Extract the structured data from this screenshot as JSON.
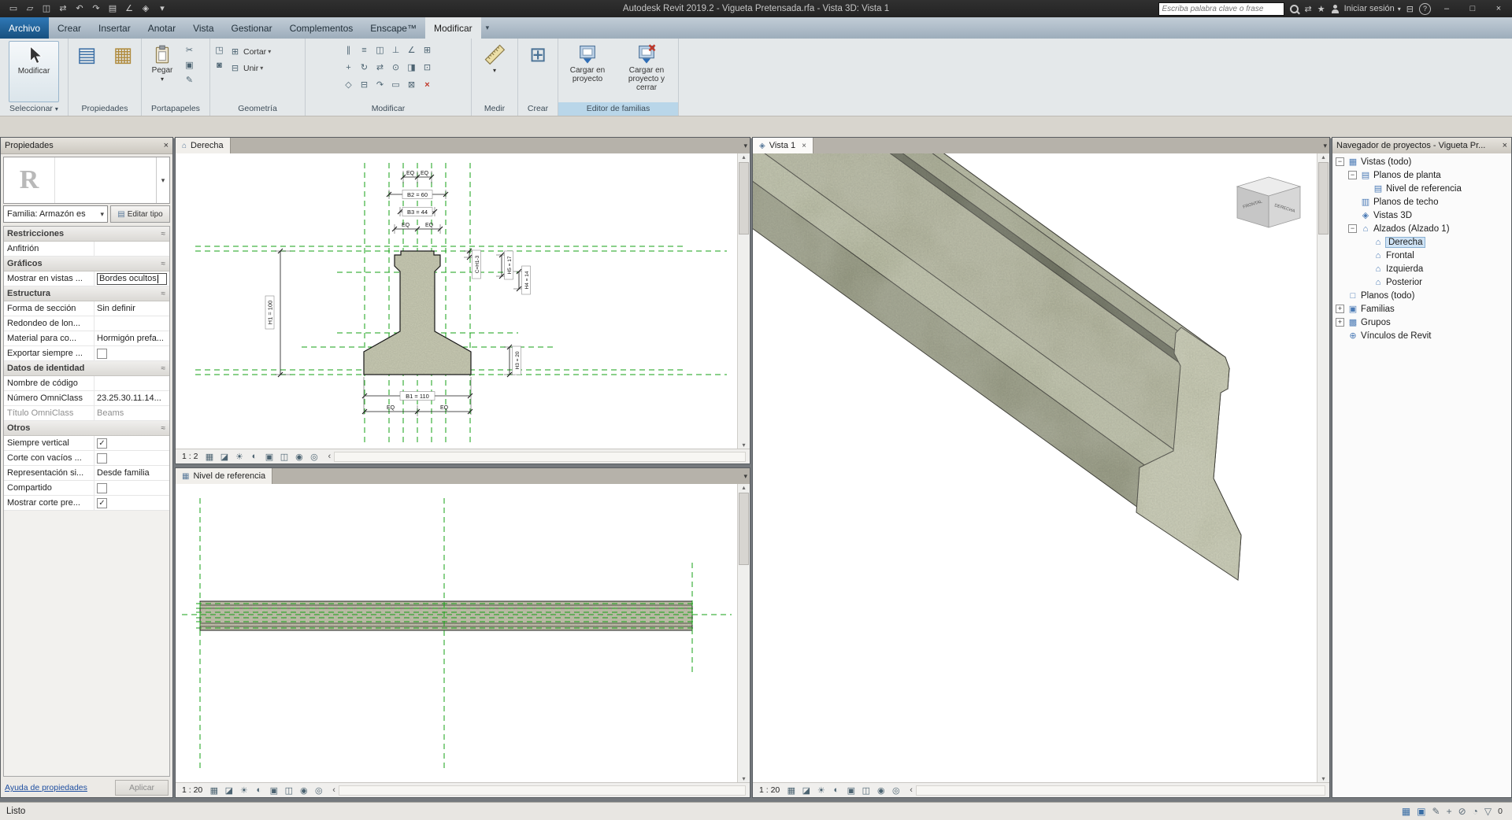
{
  "titlebar": {
    "title": "Autodesk Revit 2019.2 - Vigueta Pretensada.rfa - Vista 3D: Vista 1",
    "search_placeholder": "Escriba palabra clave o frase",
    "sign_in_label": "Iniciar sesión"
  },
  "tabs": [
    "Archivo",
    "Crear",
    "Insertar",
    "Anotar",
    "Vista",
    "Gestionar",
    "Complementos",
    "Enscape™",
    "Modificar"
  ],
  "ribbon": {
    "modify_button": "Modificar",
    "labels": {
      "seleccionar": "Seleccionar",
      "propiedades": "Propiedades",
      "portapapeles": "Portapapeles",
      "geometria": "Geometría",
      "modificar": "Modificar",
      "medir": "Medir",
      "crear": "Crear",
      "editor": "Editor de familias"
    },
    "cortar": "Cortar",
    "unir": "Unir",
    "pegar": "Pegar",
    "cargar": "Cargar en proyecto",
    "cargar_cerrar": "Cargar en proyecto y cerrar"
  },
  "glyphs": {
    "dropdown": "▾",
    "close": "×",
    "collapse": "≈",
    "back": "‹",
    "up": "▴",
    "down": "▾",
    "star": "★",
    "exchange": "⇄",
    "cart": "⊟",
    "help": "?",
    "min": "–",
    "max": "□"
  },
  "icons": {
    "qat": [
      "▭",
      "▱",
      "◫",
      "⇄",
      "↶",
      "↷",
      "▤",
      "∠",
      "◈",
      "▾"
    ],
    "propiedades_tiles": [
      "▤",
      "▦"
    ],
    "clipboard_small": [
      "✂",
      "▣",
      "✎"
    ],
    "geometry_small": [
      "◳",
      "◙",
      "⊞",
      "⊟"
    ],
    "modify_grid": [
      "∥",
      "≡",
      "◫",
      "⊥",
      "∠",
      "⊞",
      "+",
      "↻",
      "⇄",
      "⊙",
      "◨",
      "⊡",
      "◇",
      "⊟",
      "↷",
      "▭",
      "⊠",
      "×"
    ],
    "view_controls": [
      "▦",
      "◪",
      "☀",
      "◐",
      "▣",
      "◫",
      "◉",
      "◎"
    ],
    "status_right": [
      "▦",
      "▣",
      "✎",
      "+",
      "⊘",
      "◔"
    ],
    "crear": "⊞",
    "elevation_tab": "⌂",
    "plan_tab": "▦",
    "view3d_tab": "◈",
    "funnel": "▽"
  },
  "properties": {
    "header": "Propiedades",
    "thumb": "R",
    "family_combo": "Familia: Armazón es",
    "edit_type": "Editar tipo",
    "rows": [
      {
        "label": "Restricciones"
      },
      {
        "label": "Anfitrión",
        "value": ""
      },
      {
        "label": "Gráficos"
      },
      {
        "label": "Mostrar en vistas ...",
        "value": "Bordes ocultos"
      },
      {
        "label": "Estructura"
      },
      {
        "label": "Forma de sección",
        "value": "Sin definir"
      },
      {
        "label": "Redondeo de lon...",
        "value": ""
      },
      {
        "label": "Material para co...",
        "value": "Hormigón prefa..."
      },
      {
        "label": "Exportar siempre ...",
        "mark": ""
      },
      {
        "label": "Datos de identidad"
      },
      {
        "label": "Nombre de código",
        "value": ""
      },
      {
        "label": "Número OmniClass",
        "value": "23.25.30.11.14..."
      },
      {
        "label": "Título OmniClass",
        "value": "Beams"
      },
      {
        "label": "Otros"
      },
      {
        "label": "Siempre vertical",
        "mark": "✓"
      },
      {
        "label": "Corte con vacíos ...",
        "mark": ""
      },
      {
        "label": "Representación si...",
        "value": "Desde familia"
      },
      {
        "label": "Compartido",
        "mark": ""
      },
      {
        "label": "Mostrar corte pre...",
        "mark": "✓"
      }
    ],
    "help_link": "Ayuda de propiedades",
    "apply": "Aplicar"
  },
  "views": {
    "derecha": {
      "title": "Derecha",
      "scale": "1 : 2"
    },
    "nivel": {
      "title": "Nivel de referencia",
      "scale": "1 : 20"
    },
    "vista1": {
      "title": "Vista 1",
      "scale": "1 : 20"
    },
    "dims": {
      "eq": "EQ",
      "b2": "B2 = 60",
      "b3": "B3 = 44",
      "b1": "B1 = 110",
      "h1": "H1 = 100",
      "c": "C=H1-3",
      "h5": "H5 = 17",
      "h4": "H4 = 14",
      "h3": "H3 = 20"
    },
    "viewcube": {
      "right": "DERECHA",
      "front": "FRONTAL"
    }
  },
  "browser": {
    "header": "Navegador de proyectos - Vigueta Pr...",
    "tree": [
      {
        "exp": "−",
        "label": "Vistas (todo)"
      },
      {
        "exp": "−",
        "label": "Planos de planta"
      },
      {
        "exp": "",
        "label": "Nivel de referencia"
      },
      {
        "exp": "",
        "label": "Planos de techo"
      },
      {
        "exp": "",
        "label": "Vistas 3D"
      },
      {
        "exp": "−",
        "label": "Alzados (Alzado 1)"
      },
      {
        "exp": "",
        "label": "Derecha"
      },
      {
        "exp": "",
        "label": "Frontal"
      },
      {
        "exp": "",
        "label": "Izquierda"
      },
      {
        "exp": "",
        "label": "Posterior"
      },
      {
        "exp": "",
        "label": "Planos (todo)"
      },
      {
        "exp": "+",
        "label": "Familias"
      },
      {
        "exp": "+",
        "label": "Grupos"
      },
      {
        "exp": "",
        "label": "Vínculos de Revit"
      }
    ]
  },
  "statusbar": {
    "ready": "Listo",
    "filter_count": "0"
  }
}
